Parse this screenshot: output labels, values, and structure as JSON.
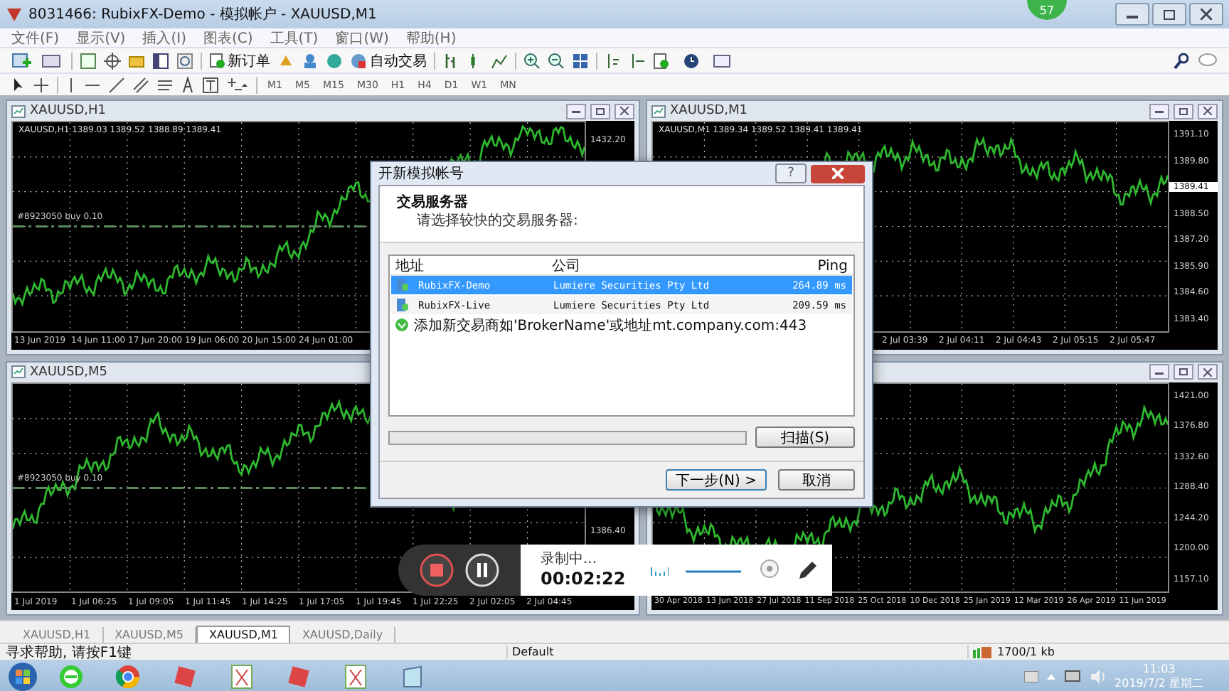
{
  "window": {
    "title": "8031466: RubixFX-Demo - 模拟帐户 - XAUUSD,M1"
  },
  "badge": "57",
  "menu": [
    "文件(F)",
    "显示(V)",
    "插入(I)",
    "图表(C)",
    "工具(T)",
    "窗口(W)",
    "帮助(H)"
  ],
  "toolbar": {
    "new_order": "新订单",
    "auto_trading": "自动交易"
  },
  "timeframes": [
    "M1",
    "M5",
    "M15",
    "M30",
    "H1",
    "H4",
    "D1",
    "W1",
    "MN"
  ],
  "charts": [
    {
      "title": "XAUUSD,H1",
      "info": "XAUUSD,H1  1389.03 1389.52 1388.89 1389.41",
      "order_label": "#8923050 buy 0.10",
      "price_labels": [
        {
          "text": "1432.20",
          "kind": "tick"
        }
      ],
      "time_labels": [
        "13 Jun 2019",
        "14 Jun 11:00",
        "17 Jun 20:00",
        "19 Jun 06:00",
        "20 Jun 15:00",
        "24 Jun 01:00"
      ]
    },
    {
      "title": "XAUUSD,M1",
      "info": "XAUUSD,M1  1389.34 1389.52 1389.41 1389.41",
      "price_labels": [
        {
          "text": "1391.10",
          "kind": "tick"
        },
        {
          "text": "1389.80",
          "kind": "tick"
        },
        {
          "text": "1389.41",
          "kind": "current"
        },
        {
          "text": "1388.50",
          "kind": "tick"
        },
        {
          "text": "1387.20",
          "kind": "tick"
        },
        {
          "text": "1385.90",
          "kind": "tick"
        },
        {
          "text": "1384.60",
          "kind": "tick"
        },
        {
          "text": "1383.40",
          "kind": "tick"
        }
      ],
      "time_labels": [
        "2 Jul 03:39",
        "2 Jul 04:11",
        "2 Jul 04:43",
        "2 Jul 05:15",
        "2 Jul 05:47"
      ]
    },
    {
      "title": "XAUUSD,M5",
      "order_label": "#8923050 buy 0.10",
      "price_labels": [
        {
          "text": "1386.40",
          "kind": "tick"
        }
      ],
      "time_labels": [
        "1 Jul 2019",
        "1 Jul 06:25",
        "1 Jul 09:05",
        "1 Jul 11:45",
        "1 Jul 14:25",
        "1 Jul 17:05",
        "1 Jul 19:45",
        "1 Jul 22:25",
        "2 Jul 02:05",
        "2 Jul 04:45"
      ]
    },
    {
      "price_labels": [
        {
          "text": "1421.00",
          "kind": "tick"
        },
        {
          "text": "1376.80",
          "kind": "tick"
        },
        {
          "text": "1332.60",
          "kind": "tick"
        },
        {
          "text": "1288.40",
          "kind": "tick"
        },
        {
          "text": "1244.20",
          "kind": "tick"
        },
        {
          "text": "1200.00",
          "kind": "tick"
        },
        {
          "text": "1157.10",
          "kind": "tick"
        }
      ],
      "time_labels": [
        "30 Apr 2018",
        "13 Jun 2018",
        "27 Jul 2018",
        "11 Sep 2018",
        "25 Oct 2018",
        "10 Dec 2018",
        "25 Jan 2019",
        "12 Mar 2019",
        "26 Apr 2019",
        "11 Jun 2019"
      ]
    }
  ],
  "dialog": {
    "title": "开新模拟帐号",
    "help": "?",
    "heading": "交易服务器",
    "subheading": "请选择较快的交易服务器:",
    "columns": [
      "地址",
      "公司",
      "Ping"
    ],
    "servers": [
      {
        "address": "RubixFX-Demo",
        "company": "Lumiere Securities Pty Ltd",
        "ping": "264.89 ms",
        "selected": true
      },
      {
        "address": "RubixFX-Live",
        "company": "Lumiere Securities Pty Ltd",
        "ping": "209.59 ms",
        "selected": false
      }
    ],
    "add_hint": "添加新交易商如'BrokerName'或地址mt.company.com:443",
    "progress": {
      "level": 0
    },
    "scan": "扫描(S)",
    "next": "下一步(N) >",
    "cancel": "取消"
  },
  "recorder": {
    "status": "录制中...",
    "time": "00:02:22"
  },
  "tabs": [
    {
      "label": "XAUUSD,H1",
      "selected": false
    },
    {
      "label": "XAUUSD,M5",
      "selected": false
    },
    {
      "label": "XAUUSD,M1",
      "selected": true
    },
    {
      "label": "XAUUSD,Daily",
      "selected": false
    }
  ],
  "status_bar": {
    "help": "寻求帮助, 请按F1键",
    "profile": "Default",
    "traffic": "1700/1 kb"
  },
  "taskbar": {
    "time": "11:03",
    "date": "2019/7/2 星期二"
  }
}
